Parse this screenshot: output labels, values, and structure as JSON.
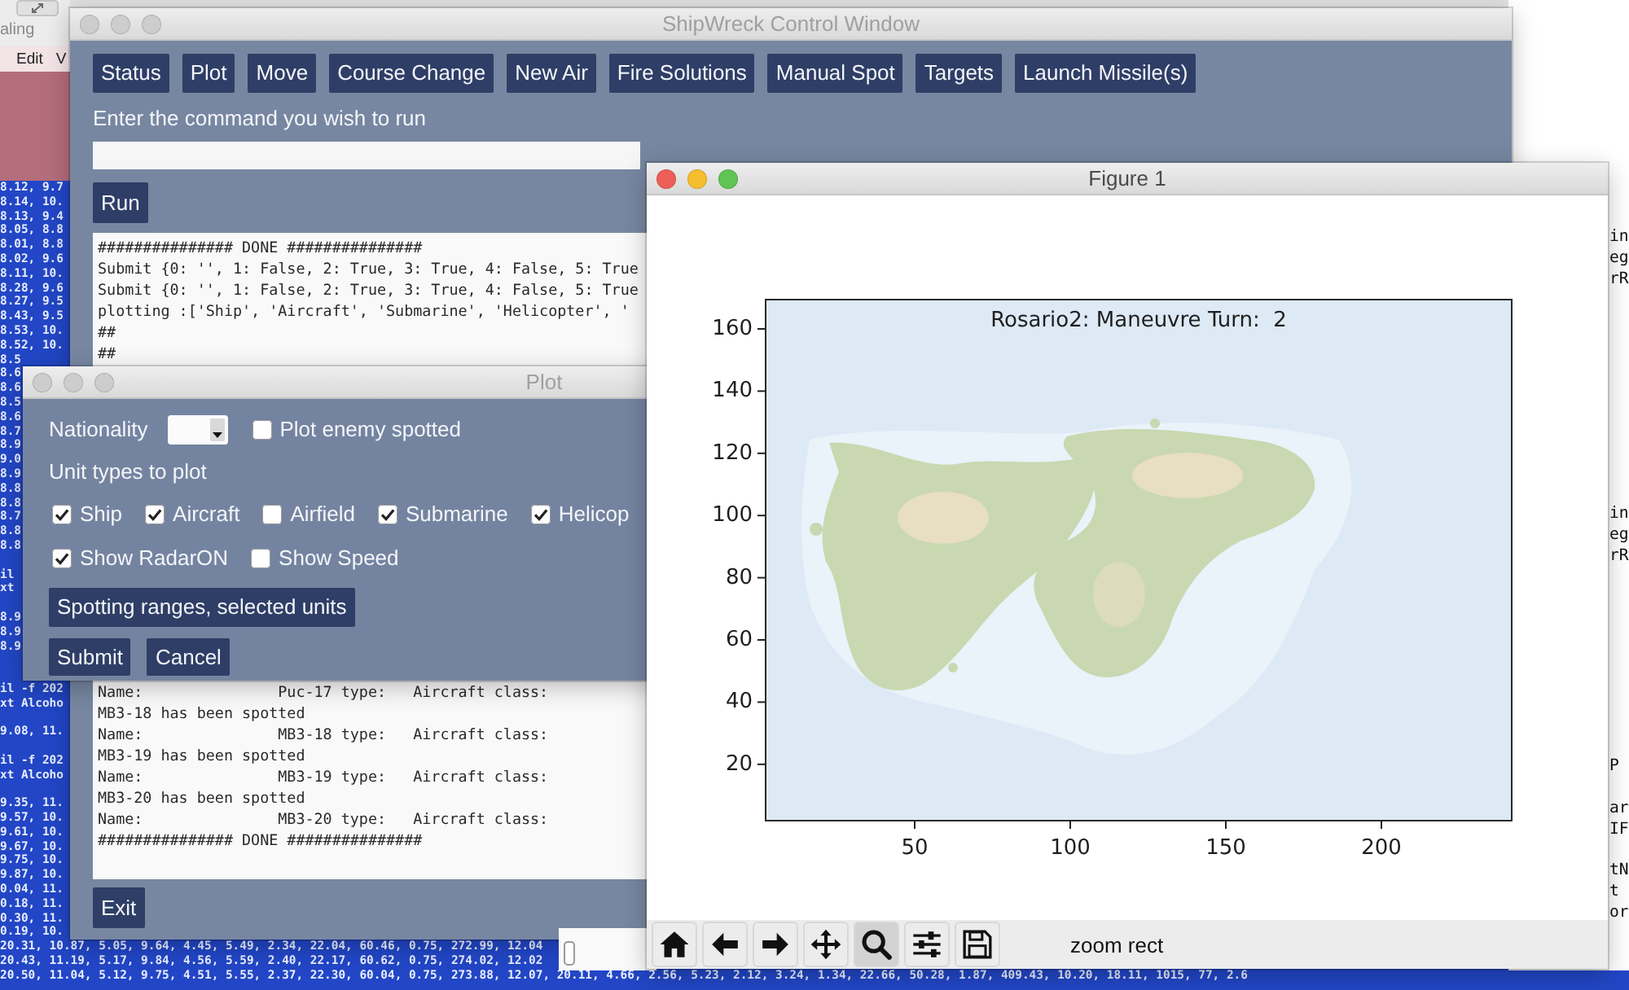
{
  "background_app": {
    "toolbar_label": "aling",
    "menu": [
      "Edit",
      "V"
    ]
  },
  "left_terminal": {
    "blocks": [
      [
        "8.12, 9.7",
        "8.14, 10.",
        "8.13, 9.4",
        "8.05, 8.8",
        "8.01, 8.8",
        "8.02, 9.6",
        "8.11, 10.",
        "8.28, 9.6",
        "8.27, 9.5",
        "8.43, 9.5",
        "8.53, 10.",
        "8.52, 10.",
        "8.5",
        "8.6",
        "8.6",
        "8.5",
        "8.6",
        "8.7",
        "8.9",
        "9.0",
        "8.9",
        "8.8",
        "8.8",
        "8.7",
        "8.8",
        "8.8"
      ],
      [
        "il",
        "xt"
      ],
      [
        "8.9",
        "8.9",
        "8.9"
      ],
      [
        "il -f 202",
        "xt Alcoho"
      ],
      [
        "9.08, 11."
      ],
      [
        "il -f 202",
        "xt Alcoho"
      ],
      [
        "9.35, 11.",
        "9.57, 10.",
        "9.61, 10.",
        "9.67, 10.",
        "9.75, 10.",
        "9.87, 10.",
        "0.04, 11.",
        "0.18, 11.",
        "0.30, 11.",
        "0.19, 10.",
        "20.31, 10.87, 5.05, 9.64, 4.45, 5.49, 2.34, 22.04, 60.46, 0.75, 272.99, 12.04",
        "20.43, 11.19, 5.17, 9.84, 4.56, 5.59, 2.40, 22.17, 60.62, 0.75, 274.02, 12.02",
        "20.50, 11.04, 5.12, 9.75, 4.51, 5.55, 2.37, 22.30, 60.04, 0.75, 273.88, 12.07, 20.11, 4.66, 2.56, 5.23, 2.12, 3.24, 1.34, 22.66, 50.28, 1.87, 409.43, 10.20, 18.11, 1015, 77, 2.6"
      ]
    ]
  },
  "right_terminal": {
    "blocks": [
      [
        "in",
        "eg",
        "rR"
      ],
      [
        "in",
        "eg",
        "rR"
      ],
      [
        "P"
      ],
      [
        "ar",
        "IF"
      ],
      [
        "tN",
        "t",
        "or"
      ]
    ]
  },
  "control_window": {
    "title": "ShipWreck Control Window",
    "active": false,
    "commands": [
      "Status",
      "Plot",
      "Move",
      "Course Change",
      "New Air",
      "Fire Solutions",
      "Manual Spot",
      "Targets",
      "Launch Missile(s)"
    ],
    "prompt": "Enter the command you wish to run",
    "run_button": "Run",
    "console": {
      "lines": [
        "############### DONE ###############",
        "Submit {0: '', 1: False, 2: True, 3: True, 4: False, 5: True",
        "Submit {0: '', 1: False, 2: True, 3: True, 4: False, 5: True",
        "plotting :['Ship', 'Aircraft', 'Submarine', 'Helicopter', '",
        "##",
        "##"
      ],
      "lines_below_dialog": [
        "Name:               Puc-17 type:   Aircraft class:",
        "MB3-18 has been spotted",
        "Name:               MB3-18 type:   Aircraft class:",
        "MB3-19 has been spotted",
        "Name:               MB3-19 type:   Aircraft class:",
        "MB3-20 has been spotted",
        "Name:               MB3-20 type:   Aircraft class:",
        "############### DONE ###############"
      ]
    },
    "exit_button": "Exit"
  },
  "plot_dialog": {
    "title": "Plot",
    "active": false,
    "nationality": {
      "label": "Nationality"
    },
    "enemy_spotted": {
      "label": "Plot enemy spotted",
      "checked": false
    },
    "unit_types_label": "Unit types to plot",
    "unit_types": [
      {
        "label": "Ship",
        "checked": true
      },
      {
        "label": "Aircraft",
        "checked": true
      },
      {
        "label": "Airfield",
        "checked": false
      },
      {
        "label": "Submarine",
        "checked": true
      },
      {
        "label": "Helicop",
        "checked": true
      }
    ],
    "options": [
      {
        "label": "Show RadarON",
        "checked": true
      },
      {
        "label": "Show Speed",
        "checked": false
      }
    ],
    "spotting_button": "Spotting ranges, selected units",
    "actions": [
      "Submit",
      "Cancel"
    ]
  },
  "figure": {
    "title": "Figure 1",
    "active": true,
    "plot": {
      "title": "Rosario2: Maneuvre Turn:  2",
      "y_tick_labels": [
        "160",
        "140",
        "120",
        "100",
        "80",
        "60",
        "40",
        "20"
      ],
      "x_tick_labels": [
        "50",
        "100",
        "150",
        "200"
      ]
    },
    "toolbar": {
      "buttons": [
        {
          "kind": "home",
          "selected": false
        },
        {
          "kind": "back",
          "selected": false
        },
        {
          "kind": "forward",
          "selected": false
        },
        {
          "kind": "pan",
          "selected": false
        },
        {
          "kind": "zoom",
          "selected": true
        },
        {
          "kind": "configure",
          "selected": false
        },
        {
          "kind": "save",
          "selected": false
        }
      ],
      "message": "zoom rect"
    }
  }
}
